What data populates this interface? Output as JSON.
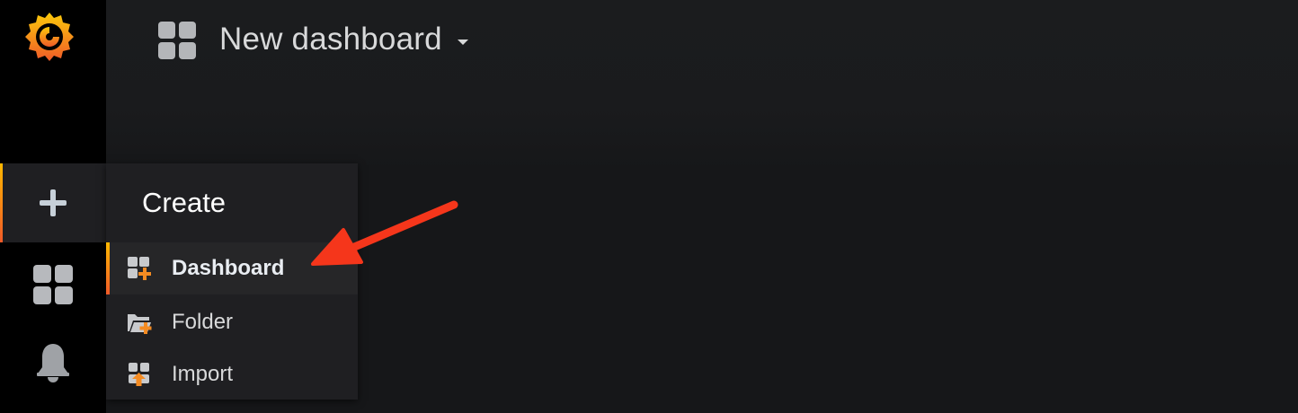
{
  "app": {
    "name": "Grafana",
    "accent_color": "#f05a28"
  },
  "navbar": {
    "dashboard_icon": "apps-grid-icon",
    "title": "New dashboard",
    "caret_icon": "caret-down-icon"
  },
  "sidemenu": {
    "logo": "grafana-logo",
    "items": [
      {
        "name": "create",
        "icon": "plus-icon",
        "active": true
      },
      {
        "name": "dashboards",
        "icon": "apps-grid-icon",
        "active": false
      },
      {
        "name": "alerting",
        "icon": "bell-icon",
        "active": false
      }
    ]
  },
  "create_menu": {
    "header": "Create",
    "items": [
      {
        "label": "Dashboard",
        "icon": "dashboard-add-icon",
        "active": true
      },
      {
        "label": "Folder",
        "icon": "folder-add-icon",
        "active": false
      },
      {
        "label": "Import",
        "icon": "import-icon",
        "active": false
      }
    ]
  },
  "annotation": {
    "type": "arrow",
    "color": "#f5361b",
    "points_to": "Dashboard"
  }
}
